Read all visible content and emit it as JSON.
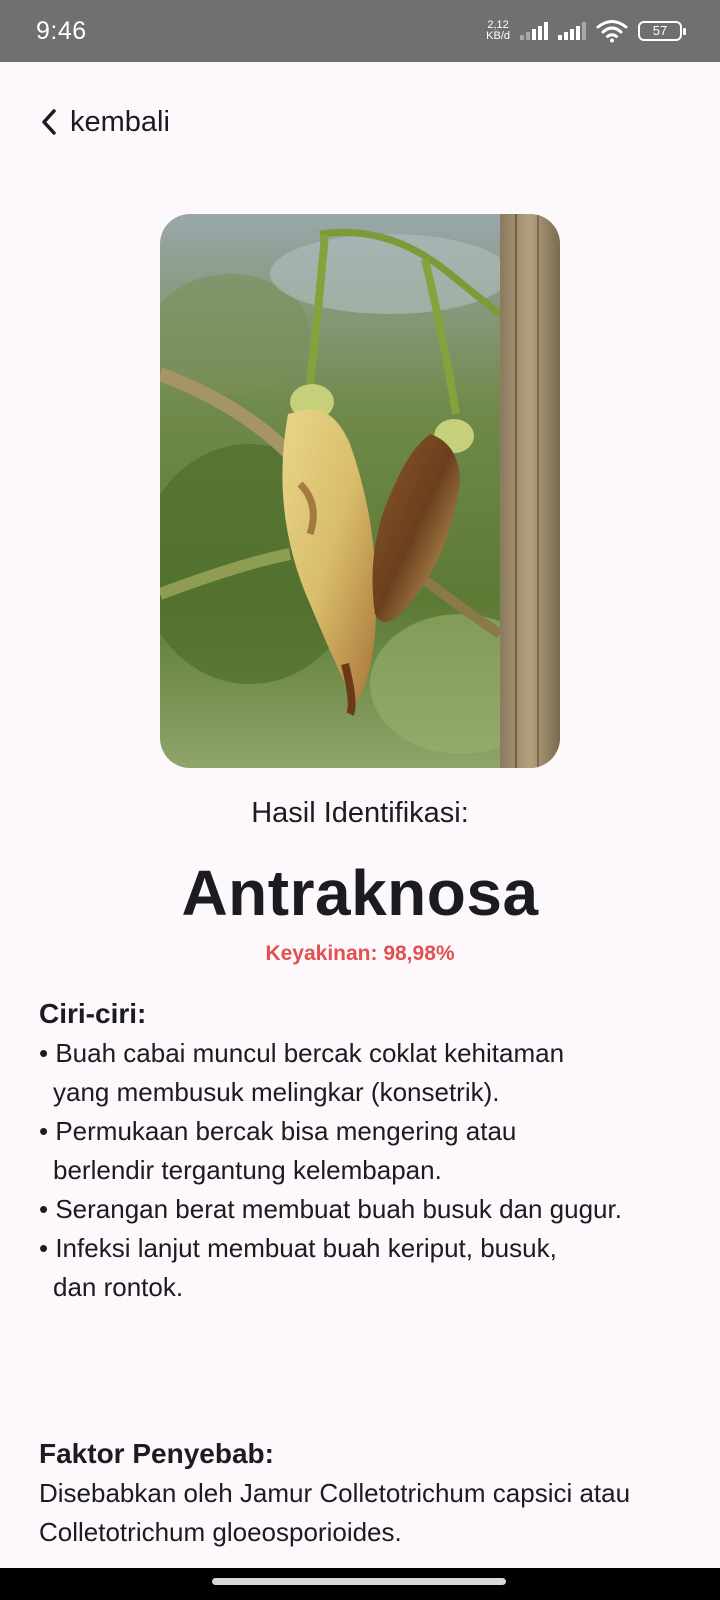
{
  "status_bar": {
    "time": "9:46",
    "net_speed_value": "2,12",
    "net_speed_unit": "KB/d",
    "battery": "57"
  },
  "nav": {
    "back_label": "kembali"
  },
  "result": {
    "heading": "Hasil Identifikasi:",
    "disease_name": "Antraknosa",
    "confidence": "Keyakinan: 98,98%"
  },
  "characteristics": {
    "title": "Ciri-ciri:",
    "lines": [
      "• Buah cabai muncul bercak coklat kehitaman",
      "yang membusuk melingkar (konsetrik).",
      "• Permukaan bercak bisa mengering atau",
      "berlendir tergantung kelembapan.",
      "• Serangan berat membuat buah busuk dan gugur.",
      "• Infeksi lanjut membuat buah keriput, busuk,",
      "dan rontok."
    ]
  },
  "cause": {
    "title": "Faktor Penyebab:",
    "text": "Disebabkan oleh Jamur Colletotrichum capsici atau Colletotrichum gloeosporioides."
  },
  "colors": {
    "background": "#fcf8fc",
    "confidence": "#e25050",
    "status_bar": "#707070"
  }
}
